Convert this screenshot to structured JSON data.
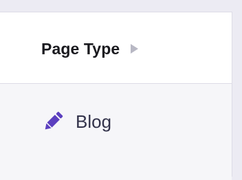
{
  "table": {
    "column_header": "Page Type",
    "sort_icon": "caret-right-icon",
    "rows": [
      {
        "icon": "pencil-icon",
        "label": "Blog"
      }
    ]
  },
  "colors": {
    "accent": "#5b3fbf",
    "caret": "#b8b8c4",
    "header_text": "#1a1a1f",
    "cell_text": "#32324a"
  }
}
